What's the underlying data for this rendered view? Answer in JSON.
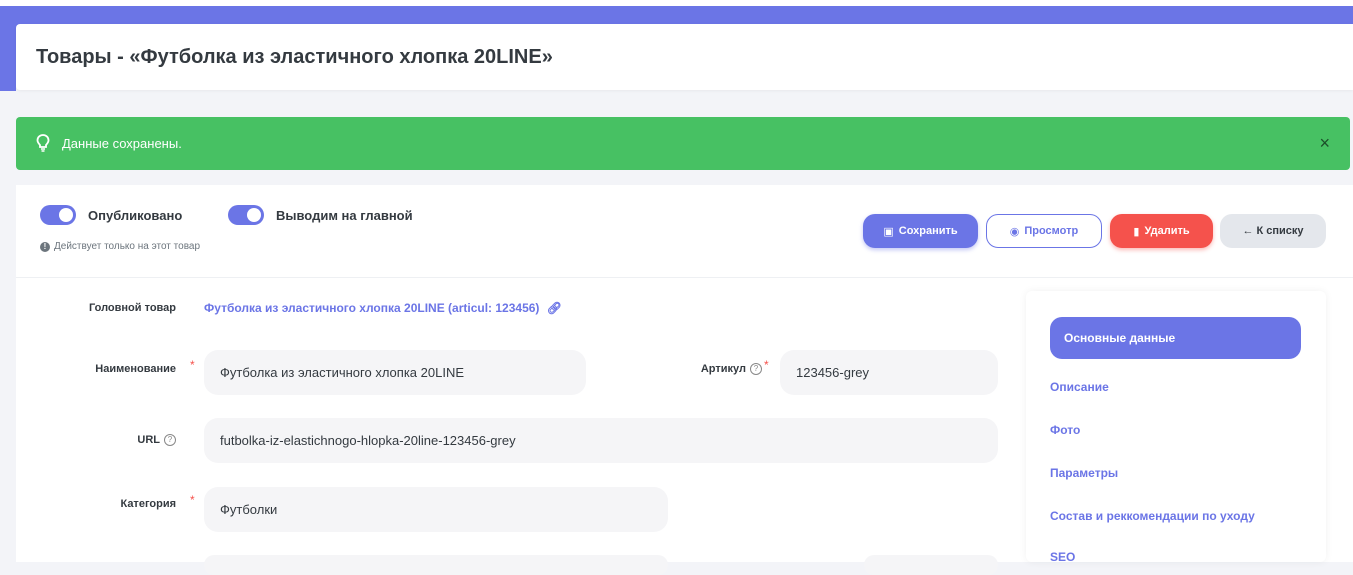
{
  "page": {
    "title": "Товары - «Футболка из эластичного хлопка 20LINE»"
  },
  "alert": {
    "message": "Данные сохранены.",
    "close": "×",
    "color": "#47c163"
  },
  "toolbar": {
    "published_label": "Опубликовано",
    "featured_label": "Выводим на главной",
    "hint": "Действует только на этот товар",
    "save_label": "Сохранить",
    "view_label": "Просмотр",
    "delete_label": "Удалить",
    "back_label": "← К списку",
    "published_on": true,
    "featured_on": true
  },
  "form": {
    "parent_label": "Головной товар",
    "parent_value": "Футболка из эластичного хлопка 20LINE (articul: 123456)",
    "name_label": "Наименование",
    "name_value": "Футболка из эластичного хлопка 20LINE",
    "sku_label": "Артикул",
    "sku_value": "123456-grey",
    "url_label": "URL",
    "url_value": "futbolka-iz-elastichnogo-hlopka-20line-123456-grey",
    "category_label": "Категория",
    "category_value": "Футболки",
    "required_mark": "*"
  },
  "sidebar": {
    "items": [
      {
        "label": "Основные данные",
        "active": true
      },
      {
        "label": "Описание"
      },
      {
        "label": "Фото"
      },
      {
        "label": "Параметры"
      },
      {
        "label": "Состав и реккомендации по уходу"
      },
      {
        "label": "SEO"
      }
    ]
  },
  "colors": {
    "accent": "#6b75e6",
    "danger": "#f5524c",
    "success": "#47c163"
  }
}
